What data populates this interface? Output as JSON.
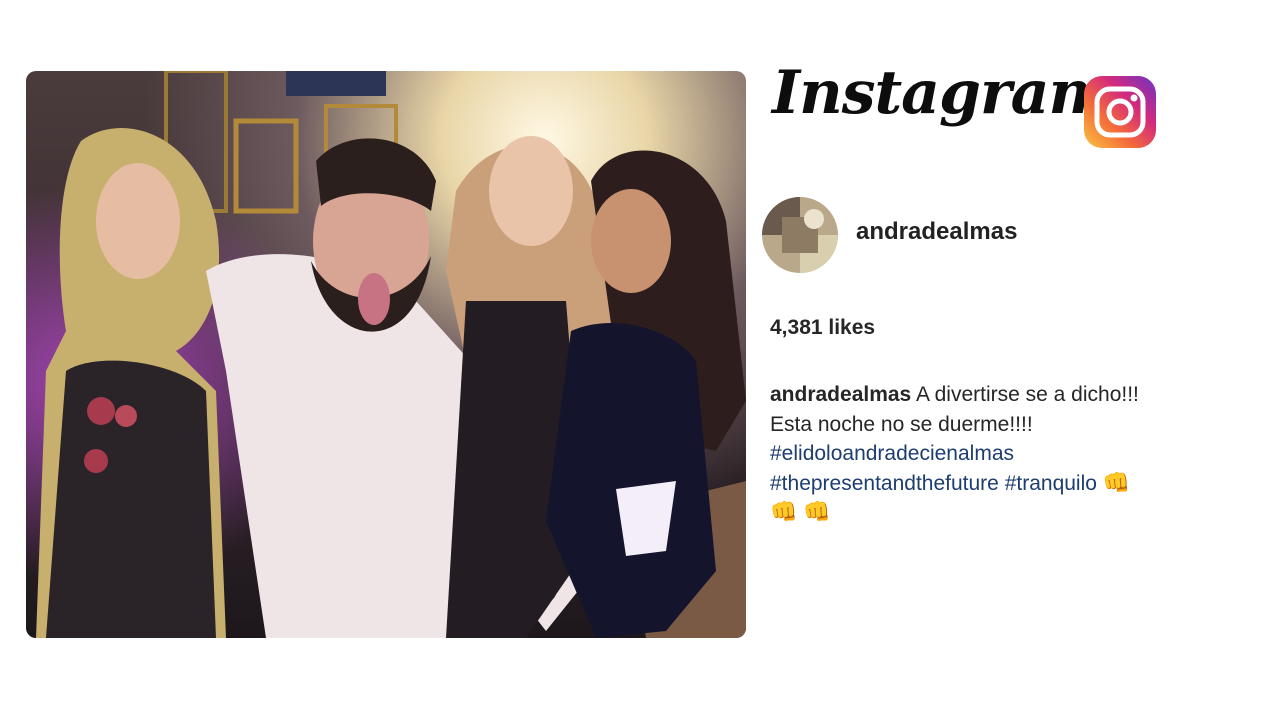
{
  "brand": {
    "wordmark": "Instagram",
    "logo_icon": "instagram-camera-icon"
  },
  "post": {
    "username": "andradealmas",
    "likes": "4,381 likes",
    "caption": {
      "user": "andradealmas",
      "line1": "A divertirse se a dicho!!!",
      "line2": "Esta noche no se duerme!!!!",
      "hashtag1": "#elidoloandradecienalmas",
      "hashtag2": "#thepresentandthefuture",
      "hashtag3": "#tranquilo",
      "emoji1": "👊",
      "emoji2": "👊",
      "emoji3": "👊"
    }
  },
  "colors": {
    "hashtag": "#1d3d70",
    "text": "#262626",
    "background": "#ffffff"
  }
}
